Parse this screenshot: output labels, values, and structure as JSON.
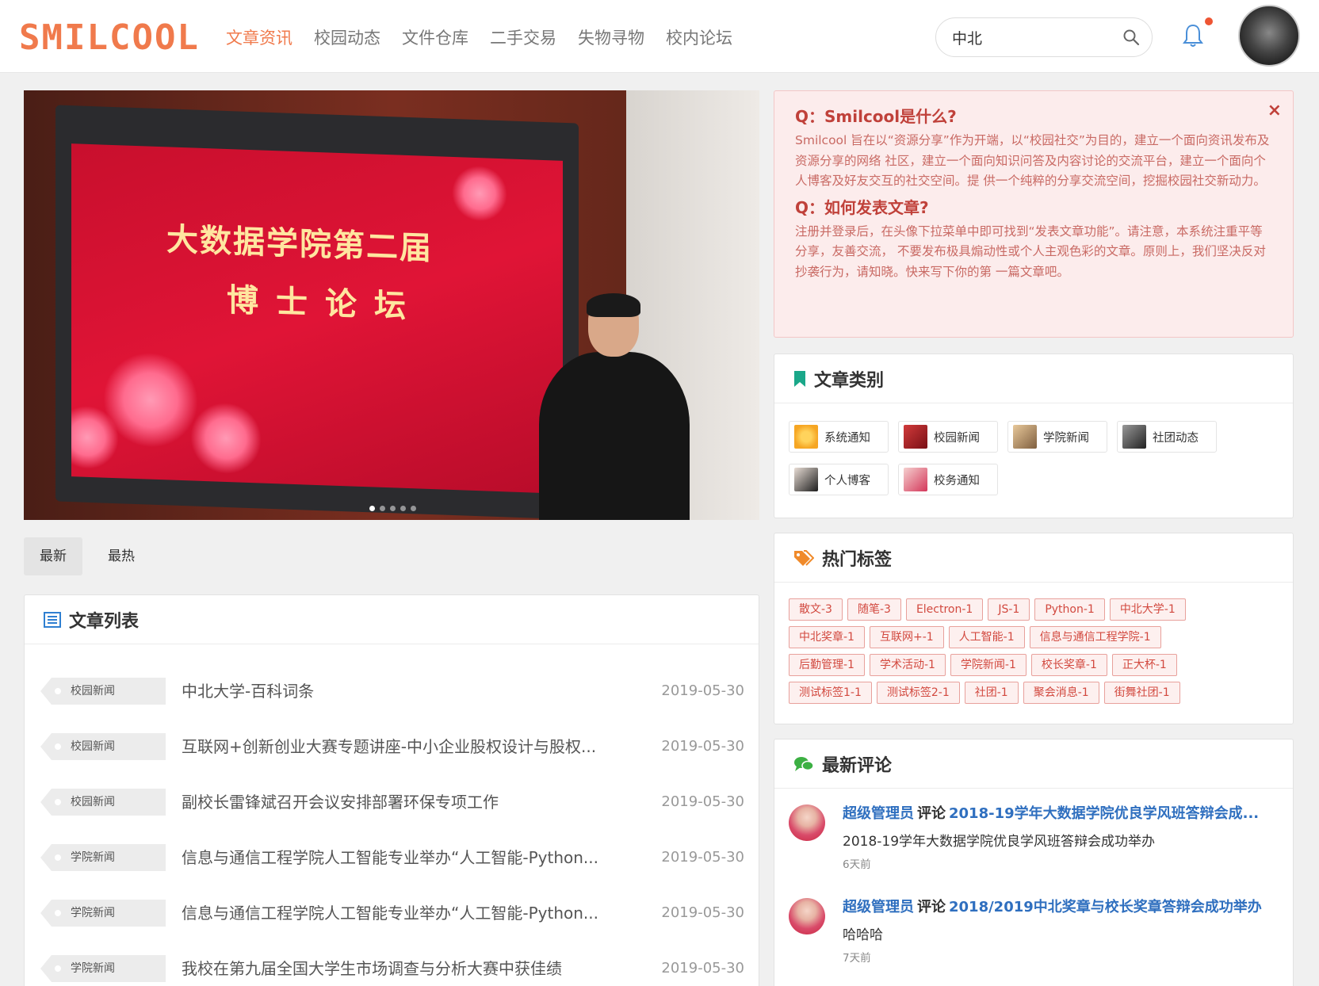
{
  "header": {
    "logo": "SMILCOOL",
    "nav": [
      "文章资讯",
      "校园动态",
      "文件仓库",
      "二手交易",
      "失物寻物",
      "校内论坛"
    ],
    "search_value": "中北"
  },
  "carousel": {
    "line1": "大数据学院第二届",
    "line2": "博士论坛"
  },
  "tabs": [
    "最新",
    "最热"
  ],
  "article_panel": {
    "title": "文章列表",
    "rows": [
      {
        "tag": "校园新闻",
        "title": "中北大学-百科词条",
        "date": "2019-05-30"
      },
      {
        "tag": "校园新闻",
        "title": "互联网+创新创业大赛专题讲座-中小企业股权设计与股权...",
        "date": "2019-05-30"
      },
      {
        "tag": "校园新闻",
        "title": "副校长雷锋斌召开会议安排部署环保专项工作",
        "date": "2019-05-30"
      },
      {
        "tag": "学院新闻",
        "title": "信息与通信工程学院人工智能专业举办“人工智能-Python...",
        "date": "2019-05-30"
      },
      {
        "tag": "学院新闻",
        "title": "信息与通信工程学院人工智能专业举办“人工智能-Python...",
        "date": "2019-05-30"
      },
      {
        "tag": "学院新闻",
        "title": "我校在第九届全国大学生市场调查与分析大赛中获佳绩",
        "date": "2019-05-30"
      }
    ]
  },
  "faq": {
    "close": "×",
    "q1": "Q：Smilcool是什么?",
    "a1": "Smilcool 旨在以“资源分享”作为开端，以“校园社交”为目的，建立一个面向资讯发布及资源分享的网络 社区，建立一个面向知识问答及内容讨论的交流平台，建立一个面向个人博客及好友交互的社交空间。提 供一个纯粹的分享交流空间，挖掘校园社交新动力。",
    "q2": "Q：如何发表文章?",
    "a2": "注册并登录后，在头像下拉菜单中即可找到“发表文章功能”。请注意，本系统注重平等分享，友善交流， 不要发布极具煽动性或个人主观色彩的文章。原则上，我们坚决反对抄袭行为，请知晓。快来写下你的第 一篇文章吧。"
  },
  "categories": {
    "title": "文章类别",
    "items": [
      {
        "label": "系统通知",
        "thumb": "#f6c23e"
      },
      {
        "label": "校园新闻",
        "thumb": "#b3242b"
      },
      {
        "label": "学院新闻",
        "thumb": "#c9a27a"
      },
      {
        "label": "社团动态",
        "thumb": "#555555"
      },
      {
        "label": "个人博客",
        "thumb": "#3a3a3a"
      },
      {
        "label": "校务通知",
        "thumb": "#e77a8c"
      }
    ]
  },
  "tags": {
    "title": "热门标签",
    "items": [
      "散文-3",
      "随笔-3",
      "Electron-1",
      "JS-1",
      "Python-1",
      "中北大学-1",
      "中北奖章-1",
      "互联网+-1",
      "人工智能-1",
      "信息与通信工程学院-1",
      "后勤管理-1",
      "学术活动-1",
      "学院新闻-1",
      "校长奖章-1",
      "正大杯-1",
      "测试标签1-1",
      "测试标签2-1",
      "社团-1",
      "聚会消息-1",
      "街舞社团-1"
    ]
  },
  "comments": {
    "title": "最新评论",
    "items": [
      {
        "user": "超级管理员",
        "verb": "评论",
        "target": "2018-19学年大数据学院优良学风班答辩会成...",
        "text": "2018-19学年大数据学院优良学风班答辩会成功举办",
        "time": "6天前"
      },
      {
        "user": "超级管理员",
        "verb": "评论",
        "target": "2018/2019中北奖章与校长奖章答辩会成功举办",
        "text": "哈哈哈",
        "time": "7天前"
      }
    ]
  },
  "colors": {
    "accent": "#f07a4c",
    "tag_red": "#d2493f",
    "link_blue": "#2f6fbf"
  }
}
